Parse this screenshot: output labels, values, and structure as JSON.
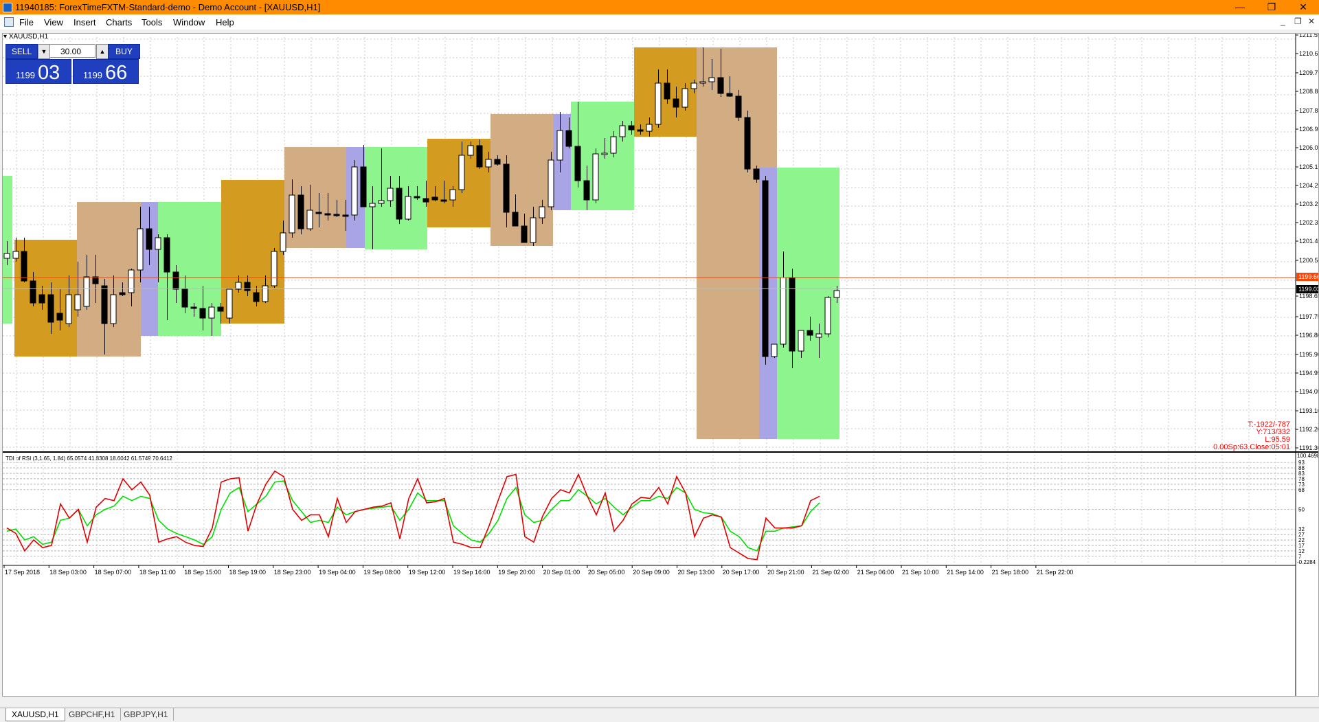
{
  "window": {
    "title": "11940185: ForexTimeFXTM-Standard-demo - Demo Account - [XAUUSD,H1]"
  },
  "menu": [
    "File",
    "View",
    "Insert",
    "Charts",
    "Tools",
    "Window",
    "Help"
  ],
  "chart": {
    "symbol_label": "XAUUSD,H1",
    "price_axis": [
      "1211.55",
      "1210.65",
      "1209.70",
      "1208.80",
      "1207.85",
      "1206.95",
      "1206.05",
      "1205.10",
      "1204.20",
      "1203.25",
      "1202.35",
      "1201.40",
      "1200.50",
      "1198.65",
      "1197.75",
      "1196.80",
      "1195.90",
      "1194.95",
      "1194.05",
      "1193.10",
      "1192.20",
      "1191.30"
    ],
    "current_line_label": "1199.66",
    "bid_label": "1199.03",
    "info_lines": [
      "T:-1922/-787",
      "Y:713/332",
      "L:95.59",
      "0.00Sp:63.Close:05:01"
    ],
    "time_axis": [
      "17 Sep 2018",
      "18 Sep 03:00",
      "18 Sep 07:00",
      "18 Sep 11:00",
      "18 Sep 15:00",
      "18 Sep 19:00",
      "18 Sep 23:00",
      "19 Sep 04:00",
      "19 Sep 08:00",
      "19 Sep 12:00",
      "19 Sep 16:00",
      "19 Sep 20:00",
      "20 Sep 01:00",
      "20 Sep 05:00",
      "20 Sep 09:00",
      "20 Sep 13:00",
      "20 Sep 17:00",
      "20 Sep 21:00",
      "21 Sep 02:00",
      "21 Sep 06:00",
      "21 Sep 10:00",
      "21 Sep 14:00",
      "21 Sep 18:00",
      "21 Sep 22:00"
    ]
  },
  "trade_panel": {
    "sell_label": "SELL",
    "buy_label": "BUY",
    "lot": "30.00",
    "bid_small": "1199",
    "bid_big": "03",
    "ask_small": "1199",
    "ask_big": "66"
  },
  "indicator": {
    "label": "TDI of RSI  (3,1.65, 1.84) 65.0574 41.8308 18.6042 61.5749 70.6412",
    "top_label": "100.4698",
    "bottom_label": "-0.2284",
    "levels": [
      "93",
      "88",
      "83",
      "78",
      "73",
      "68",
      "50",
      "32",
      "27",
      "22",
      "17",
      "12",
      "7"
    ],
    "colors": {
      "rsi": "#e00000",
      "signal": "#00e000"
    }
  },
  "tabs": [
    "XAUUSD,H1",
    "GBPCHF,H1",
    "GBPJPY,H1"
  ]
}
